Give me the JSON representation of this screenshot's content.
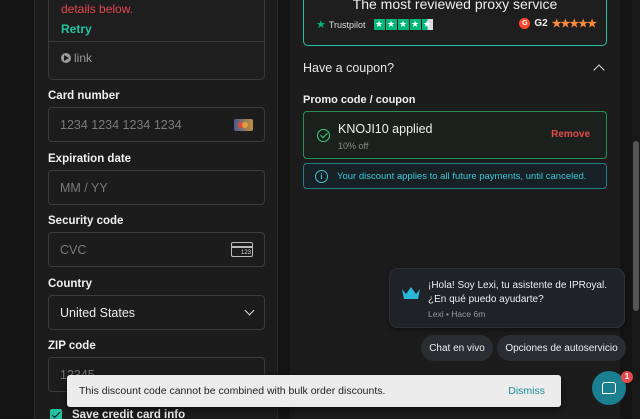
{
  "payment": {
    "error_text": "details below.",
    "retry_label": "Retry",
    "link_label": "link",
    "card_number": {
      "label": "Card number",
      "placeholder": "1234 1234 1234 1234"
    },
    "expiration": {
      "label": "Expiration date",
      "placeholder": "MM / YY"
    },
    "security": {
      "label": "Security code",
      "placeholder": "CVC",
      "icon_text": "123"
    },
    "country": {
      "label": "Country",
      "value": "United States"
    },
    "zip": {
      "label": "ZIP code",
      "placeholder": "12345"
    },
    "save_card_label": "Save credit card info"
  },
  "reviews": {
    "title": "The most reviewed proxy service",
    "trustpilot_label": "Trustpilot",
    "g2_label": "G2"
  },
  "coupon": {
    "heading": "Have a coupon?",
    "promo_label": "Promo code / coupon",
    "applied_code": "KNOJI10 applied",
    "applied_discount": "10% off",
    "remove_label": "Remove",
    "info_text": "Your discount applies to all future payments, until canceled."
  },
  "chat": {
    "message": "¡Hola! Soy Lexi, tu asistente de IPRoyal. ¿En qué puedo ayudarte?",
    "meta": "Lexi • Hace 6m",
    "btn_live": "Chat en vivo",
    "btn_self": "Opciones de autoservicio",
    "badge_count": "1"
  },
  "toast": {
    "text": "This discount code cannot be combined with bulk order discounts.",
    "dismiss_label": "Dismiss"
  },
  "colors": {
    "accent": "#22c3a0",
    "error": "#e5484d",
    "success": "#3fcf7a",
    "info": "#3cc6d8"
  }
}
